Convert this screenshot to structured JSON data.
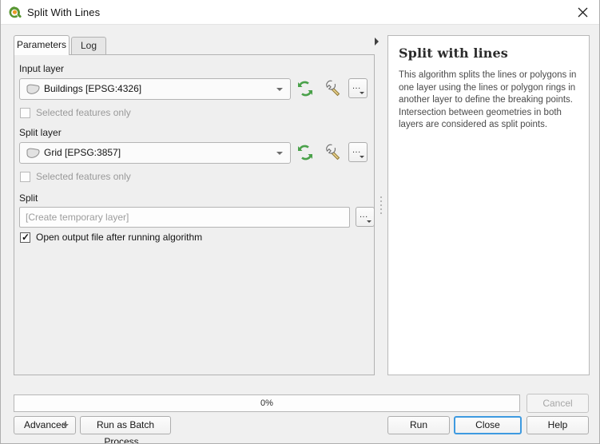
{
  "window": {
    "title": "Split With Lines",
    "app_icon": "qgis-logo-icon",
    "close_icon": "close-icon"
  },
  "tabs": [
    {
      "label": "Parameters",
      "active": true
    },
    {
      "label": "Log",
      "active": false
    }
  ],
  "parameters": {
    "input_layer": {
      "label": "Input layer",
      "value": "Buildings [EPSG:4326]",
      "layer_icon": "polygon-layer-icon",
      "iterate_icon": "iterate-refresh-icon",
      "advanced_icon": "wrench-icon",
      "browse_label": "...",
      "selected_only": {
        "label": "Selected features only",
        "checked": false,
        "enabled": false
      }
    },
    "split_layer": {
      "label": "Split layer",
      "value": "Grid [EPSG:3857]",
      "layer_icon": "polygon-layer-icon",
      "iterate_icon": "iterate-refresh-icon",
      "advanced_icon": "wrench-icon",
      "browse_label": "...",
      "selected_only": {
        "label": "Selected features only",
        "checked": false,
        "enabled": false
      }
    },
    "output": {
      "label": "Split",
      "value": "",
      "placeholder": "[Create temporary layer]",
      "browse_label": "..."
    },
    "open_output": {
      "label": "Open output file after running algorithm",
      "checked": true,
      "enabled": true
    }
  },
  "help": {
    "title": "Split with lines",
    "body": "This algorithm splits the lines or polygons in one layer using the lines or polygon rings in another layer to define the breaking points. Intersection between geometries in both layers are considered as split points."
  },
  "panel_expander_icon": "expand-right-triangle-icon",
  "splitter_icon": "splitter-grip-icon",
  "footer": {
    "progress": {
      "text": "0%",
      "value": 0
    },
    "cancel": {
      "label": "Cancel",
      "enabled": false
    },
    "advanced": {
      "label": "Advanced",
      "arrow_icon": "chevron-down-icon"
    },
    "batch": {
      "label": "Run as Batch Process..."
    },
    "run": {
      "label": "Run"
    },
    "close": {
      "label": "Close",
      "focused": true
    },
    "help": {
      "label": "Help"
    }
  },
  "colors": {
    "accent_blue": "#3e9ae0",
    "icon_green": "#4fa24f",
    "panel_bg": "#efefef",
    "window_bg": "#f0f0f0"
  }
}
